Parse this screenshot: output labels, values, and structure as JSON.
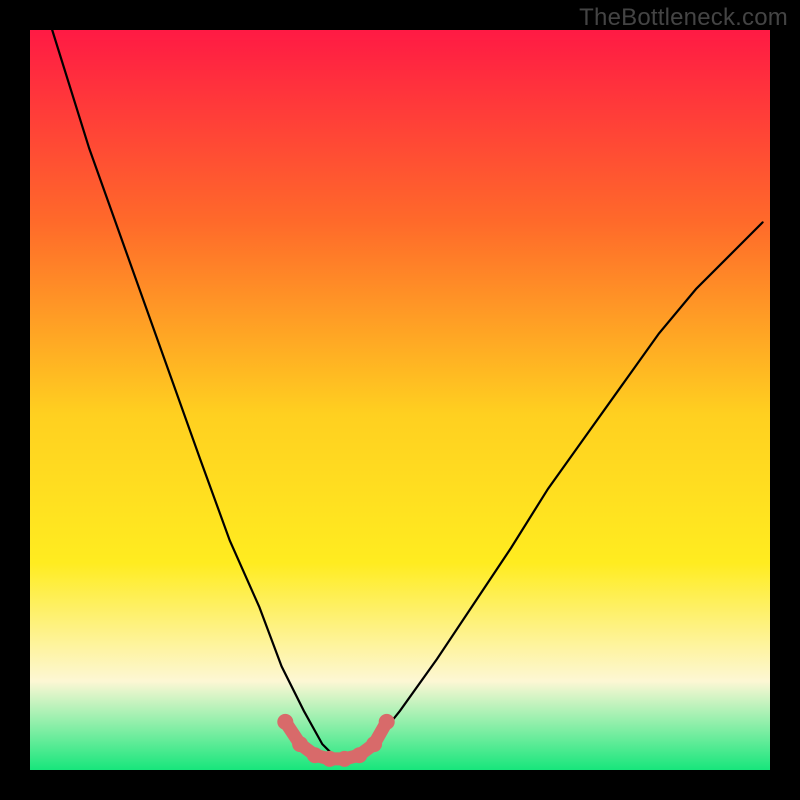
{
  "watermark": "TheBottleneck.com",
  "colors": {
    "bg": "#000000",
    "grad_top": "#ff1a44",
    "grad_mid_upper": "#ff6a2a",
    "grad_mid": "#ffd020",
    "grad_mid_lower": "#ffec20",
    "grad_cream": "#fdf7d4",
    "grad_green": "#17e67c",
    "curve_stroke": "#000000",
    "marker_stroke": "#d86a6a"
  },
  "chart_data": {
    "type": "line",
    "title": "",
    "xlabel": "",
    "ylabel": "",
    "xlim": [
      0,
      100
    ],
    "ylim": [
      0,
      100
    ],
    "grid": false,
    "series": [
      {
        "name": "bottleneck-curve",
        "x": [
          3,
          8,
          13,
          18,
          23,
          27,
          31,
          34,
          37,
          39.5,
          41.5,
          43.5,
          46,
          50,
          55,
          60,
          65,
          70,
          75,
          80,
          85,
          90,
          95,
          99
        ],
        "y": [
          100,
          84,
          70,
          56,
          42,
          31,
          22,
          14,
          8,
          3.5,
          1.5,
          1.5,
          3,
          8,
          15,
          22.5,
          30,
          38,
          45,
          52,
          59,
          65,
          70,
          74
        ]
      },
      {
        "name": "optimal-range-markers",
        "x": [
          34.5,
          36.5,
          38.5,
          40.5,
          42.5,
          44.5,
          46.5,
          48.2
        ],
        "y": [
          6.5,
          3.5,
          2.0,
          1.5,
          1.5,
          2.0,
          3.5,
          6.5
        ]
      }
    ]
  }
}
